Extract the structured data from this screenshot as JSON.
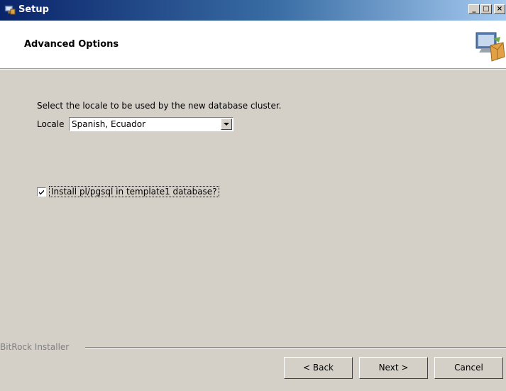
{
  "window": {
    "title": "Setup",
    "icon": "setup-app-icon",
    "controls": {
      "minimize": "_",
      "maximize": "□",
      "close": "×"
    }
  },
  "header": {
    "title": "Advanced Options",
    "icon": "installer-box-icon"
  },
  "content": {
    "prompt": "Select the locale to be used by the new database cluster.",
    "locale_label": "Locale",
    "locale_value": "Spanish, Ecuador",
    "checkbox_label": "Install pl/pgsql in template1 database?",
    "checkbox_checked": true
  },
  "footer": {
    "brand": "BitRock Installer",
    "back": "< Back",
    "next": "Next >",
    "cancel": "Cancel"
  },
  "colors": {
    "title_bar_start": "#0a246a",
    "title_bar_end": "#a6caf0",
    "dialog_face": "#d4d0c8",
    "header_bg": "#ffffff"
  }
}
